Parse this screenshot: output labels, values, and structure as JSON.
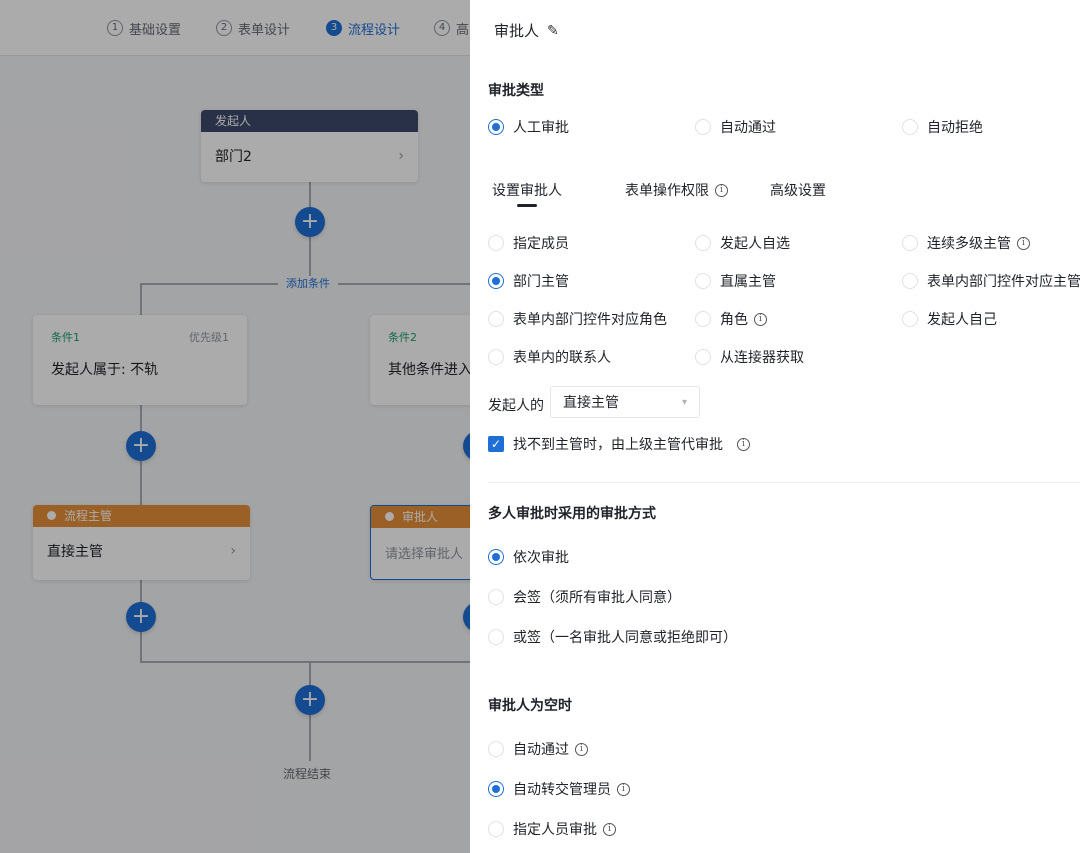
{
  "steps": [
    {
      "num": "1",
      "label": "基础设置"
    },
    {
      "num": "2",
      "label": "表单设计"
    },
    {
      "num": "3",
      "label": "流程设计"
    },
    {
      "num": "4",
      "label": "高"
    }
  ],
  "flow": {
    "start_node": {
      "header": "发起人",
      "body": "部门2"
    },
    "add_condition": "添加条件",
    "branch1": {
      "title": "条件1",
      "priority": "优先级1",
      "desc": "发起人属于: 不轨"
    },
    "branch2": {
      "title": "条件2",
      "desc": "其他条件进入"
    },
    "approver1": {
      "header": "流程主管",
      "body": "直接主管"
    },
    "approver2": {
      "header": "审批人",
      "body": "请选择审批人"
    },
    "end_label": "流程结束"
  },
  "drawer": {
    "title": "审批人",
    "approval_type": {
      "title": "审批类型",
      "options": [
        "人工审批",
        "自动通过",
        "自动拒绝"
      ],
      "selected": 0
    },
    "tabs": [
      "设置审批人",
      "表单操作权限",
      "高级设置"
    ],
    "approver_options": [
      "指定成员",
      "发起人自选",
      "连续多级主管",
      "部门主管",
      "直属主管",
      "表单内部门控件对应主管",
      "表单内部门控件对应角色",
      "角色",
      "发起人自己",
      "表单内的联系人",
      "从连接器获取"
    ],
    "approver_selected": 3,
    "initiator_label": "发起人的",
    "initiator_select_value": "直接主管",
    "fallback_checkbox": "找不到主管时，由上级主管代审批",
    "multi": {
      "title": "多人审批时采用的审批方式",
      "options": [
        "依次审批",
        "会签（须所有审批人同意）",
        "或签（一名审批人同意或拒绝即可）"
      ],
      "selected": 0
    },
    "empty": {
      "title": "审批人为空时",
      "options": [
        "自动通过",
        "自动转交管理员",
        "指定人员审批"
      ],
      "selected": 1
    }
  },
  "colors": {
    "accent": "#1f6fd6",
    "start_header": "#3d4a6b",
    "approver_header": "#e8903a",
    "condition_title": "#1ea06a"
  },
  "icons": {
    "edit": "pencil-icon",
    "info": "info-circle-icon",
    "person": "person-icon",
    "add": "plus-icon"
  }
}
